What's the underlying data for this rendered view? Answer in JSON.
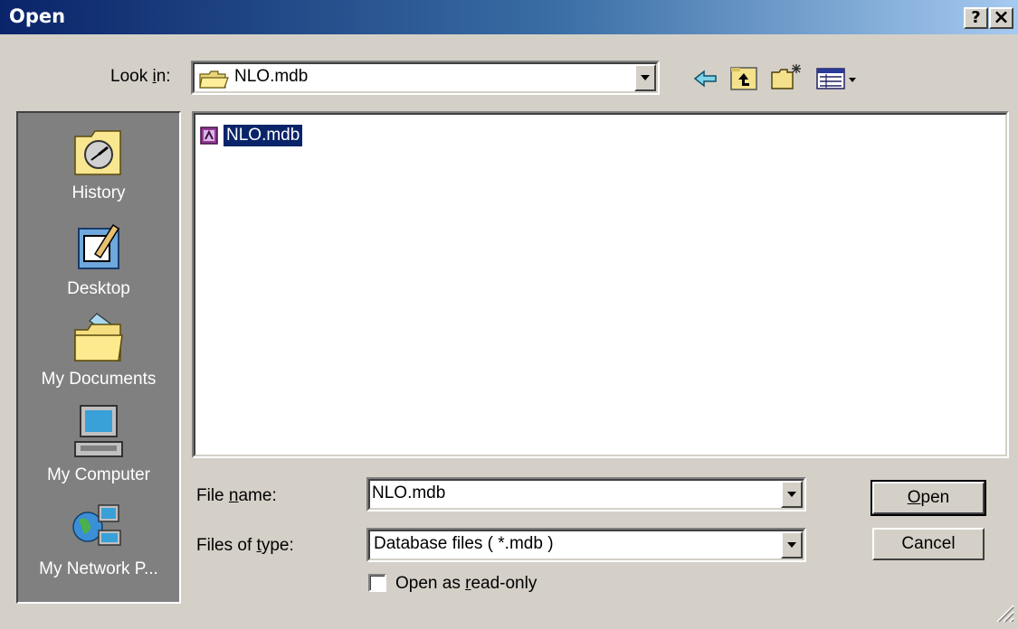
{
  "window": {
    "title": "Open",
    "help_label": "?",
    "close_label": "×"
  },
  "toolbar": {
    "look_in_label_pre": "Look ",
    "look_in_label_accel": "i",
    "look_in_label_post": "n:",
    "look_in_value": "NLO.mdb"
  },
  "places": [
    {
      "label": "History",
      "icon": "history-icon"
    },
    {
      "label": "Desktop",
      "icon": "desktop-icon"
    },
    {
      "label": "My Documents",
      "icon": "my-documents-icon"
    },
    {
      "label": "My Computer",
      "icon": "my-computer-icon"
    },
    {
      "label": "My Network P...",
      "icon": "network-places-icon"
    }
  ],
  "files": [
    {
      "name": "NLO.mdb",
      "icon": "access-database-icon",
      "selected": true
    }
  ],
  "form": {
    "file_name_label_pre": "File ",
    "file_name_label_accel": "n",
    "file_name_label_post": "ame:",
    "file_name_value": "NLO.mdb",
    "file_type_label_pre": "Files of ",
    "file_type_label_accel": "t",
    "file_type_label_post": "ype:",
    "file_type_value": "Database files ( *.mdb )",
    "readonly_pre": "Open as ",
    "readonly_accel": "r",
    "readonly_post": "ead-only",
    "readonly_checked": false
  },
  "buttons": {
    "open_accel": "O",
    "open_rest": "pen",
    "cancel_label": "Cancel"
  },
  "colors": {
    "titlebar_start": "#0a246a",
    "titlebar_end": "#a6caf0",
    "selection": "#0a246a",
    "dialog_bg": "#d4d0c8"
  }
}
